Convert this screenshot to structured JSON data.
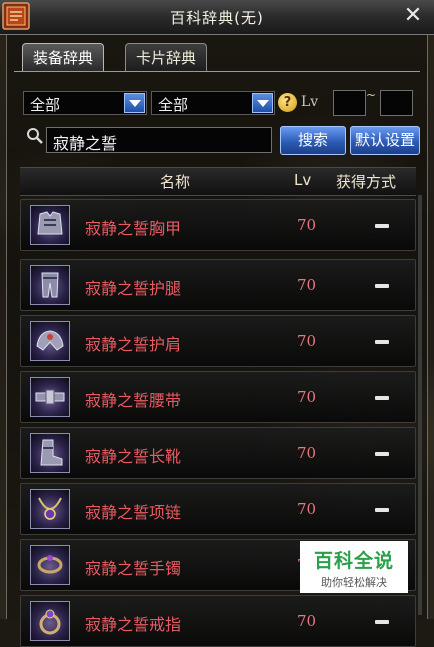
{
  "window": {
    "title": "百科辞典(无)",
    "close_symbol": "✕"
  },
  "tabs": [
    {
      "label": "装备辞典",
      "active": true
    },
    {
      "label": "卡片辞典",
      "active": false
    }
  ],
  "filters": {
    "filter1": "全部",
    "filter2": "全部",
    "help_symbol": "?",
    "lv_label": "Lv",
    "lv_separator": "~",
    "lv_min": "",
    "lv_max": ""
  },
  "search": {
    "value": "寂静之誓",
    "search_button": "搜索",
    "reset_button": "默认设置"
  },
  "table": {
    "headers": {
      "name": "名称",
      "lv": "Lv",
      "obtain": "获得方式"
    },
    "rows": [
      {
        "name": "寂静之誓胸甲",
        "lv": "70",
        "icon": "chest-armor-icon"
      },
      {
        "name": "寂静之誓护腿",
        "lv": "70",
        "icon": "leg-armor-icon"
      },
      {
        "name": "寂静之誓护肩",
        "lv": "70",
        "icon": "shoulder-armor-icon"
      },
      {
        "name": "寂静之誓腰带",
        "lv": "70",
        "icon": "belt-icon"
      },
      {
        "name": "寂静之誓长靴",
        "lv": "70",
        "icon": "boots-icon"
      },
      {
        "name": "寂静之誓项链",
        "lv": "70",
        "icon": "necklace-icon"
      },
      {
        "name": "寂静之誓手镯",
        "lv": "70",
        "icon": "bracelet-icon"
      },
      {
        "name": "寂静之誓戒指",
        "lv": "70",
        "icon": "ring-icon"
      }
    ]
  },
  "watermark": {
    "main": "百科全说",
    "sub": "助你轻松解决"
  },
  "colors": {
    "item_name": "#e85a63",
    "button_blue": "#2c5cb8",
    "watermark_green": "#2aa04a"
  }
}
